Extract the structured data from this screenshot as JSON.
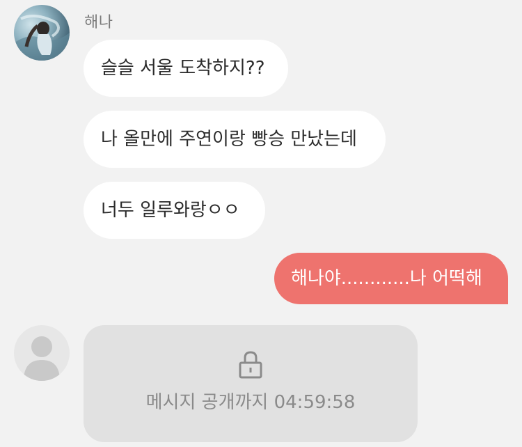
{
  "chat": {
    "sender_name": "해나",
    "incoming_messages": [
      "슬슬 서울 도착하지??",
      "나 올만에 주연이랑 빵승 만났는데",
      "너두 일루와랑ㅇㅇ"
    ],
    "outgoing_message": "해나야............나 어떡해",
    "locked_message": {
      "icon": "lock-icon",
      "countdown_label": "메시지 공개까지 04:59:58"
    }
  },
  "colors": {
    "background": "#f2f2f2",
    "incoming_bubble": "#ffffff",
    "outgoing_bubble": "#ee736e",
    "locked_card": "#e1e1e1",
    "muted_text": "#8a8a8a"
  }
}
